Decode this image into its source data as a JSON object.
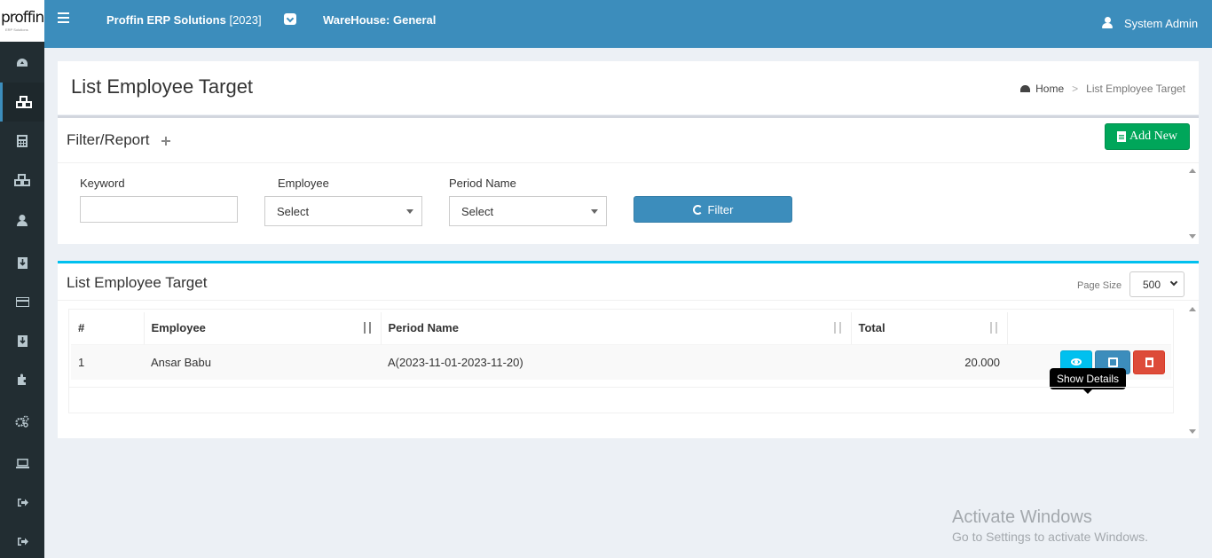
{
  "logo": {
    "text": "proffin",
    "tagline": "ERP Solutions"
  },
  "header": {
    "app_title": "Proffin ERP Solutions",
    "app_year": "[2023]",
    "warehouse": "WareHouse: General",
    "user": "System Admin"
  },
  "page": {
    "title": "List Employee Target",
    "breadcrumb": {
      "home": "Home",
      "separator": ">",
      "current": "List Employee Target"
    }
  },
  "filter": {
    "title": "Filter/Report",
    "add_new_label": "Add New",
    "keyword_label": "Keyword",
    "keyword_value": "",
    "employee_label": "Employee",
    "employee_selected": "Select",
    "period_label": "Period Name",
    "period_selected": "Select",
    "filter_button": "Filter"
  },
  "list": {
    "title": "List Employee Target",
    "page_size_label": "Page Size",
    "page_size_value": "500",
    "columns": [
      "#",
      "Employee",
      "Period Name",
      "Total"
    ],
    "rows": [
      {
        "index": "1",
        "employee": "Ansar Babu",
        "period": "A(2023-11-01-2023-11-20)",
        "total": "20.000"
      }
    ],
    "tooltip": "Show Details"
  },
  "sidebar_icons": [
    "dashboard-icon",
    "cubes-icon",
    "calculator-icon",
    "cubes-icon",
    "user-icon",
    "download-icon",
    "credit-card-icon",
    "download-icon",
    "puzzle-icon",
    "cogs-icon",
    "laptop-icon",
    "sign-out-icon",
    "sign-out-icon"
  ],
  "watermark": {
    "title": "Activate Windows",
    "subtitle": "Go to Settings to activate Windows."
  },
  "colors": {
    "primary": "#3c8dbc",
    "success": "#00a65a",
    "info": "#00c0ef",
    "danger": "#dd4b39",
    "sidebar": "#222d32"
  }
}
